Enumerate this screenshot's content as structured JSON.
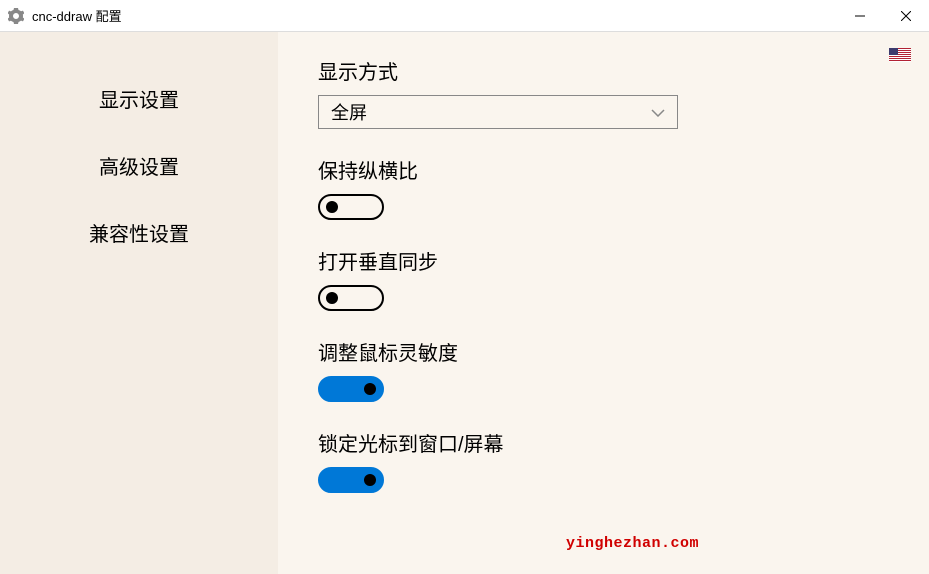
{
  "window": {
    "title": "cnc-ddraw 配置"
  },
  "sidebar": {
    "items": [
      {
        "label": "显示设置"
      },
      {
        "label": "高级设置"
      },
      {
        "label": "兼容性设置"
      }
    ]
  },
  "main": {
    "displayMode": {
      "label": "显示方式",
      "selected": "全屏"
    },
    "aspectRatio": {
      "label": "保持纵横比",
      "value": false
    },
    "vsync": {
      "label": "打开垂直同步",
      "value": false
    },
    "mouseSensitivity": {
      "label": "调整鼠标灵敏度",
      "value": true
    },
    "lockCursor": {
      "label": "锁定光标到窗口/屏幕",
      "value": true
    }
  },
  "watermark": "yinghezhan.com",
  "flag": "us"
}
